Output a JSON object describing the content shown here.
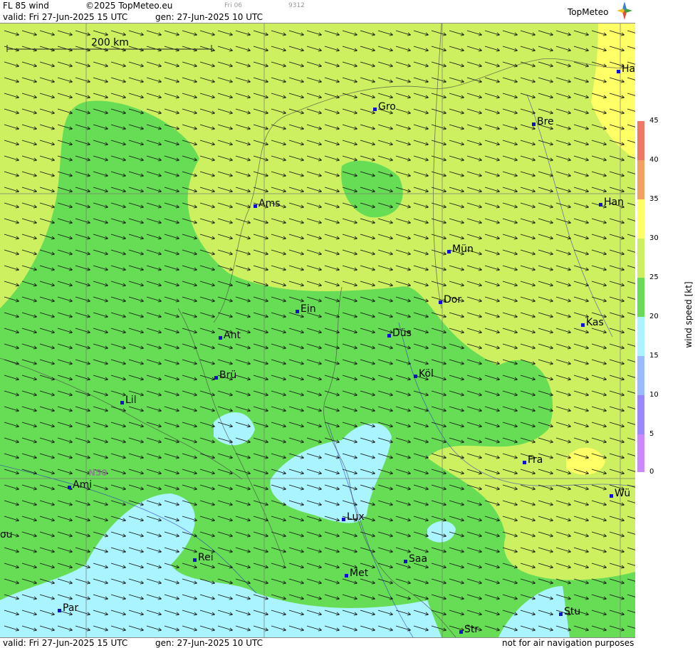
{
  "header": {
    "title": "FL 85 wind",
    "copyright": "©2025 TopMeteo.eu",
    "valid": "valid:  Fri  27-Jun-2025  15 UTC",
    "gen": "gen: 27-Jun-2025 10 UTC",
    "small_day": "Fri 06",
    "small_code": "9312",
    "logo": "TopMeteo"
  },
  "footer": {
    "valid": "valid:  Fri  27-Jun-2025  15 UTC",
    "gen": "gen: 27-Jun-2025 10 UTC",
    "disclaimer": "not for air navigation purposes"
  },
  "map": {
    "scale_label": "200 km",
    "lat_label": "N50",
    "cities": [
      "Ha",
      "Gro",
      "Bre",
      "Ams",
      "Han",
      "Mün",
      "Dor",
      "Ein",
      "Kas",
      "Ant",
      "Düs",
      "Brü",
      "Köl",
      "Lil",
      "Fra",
      "Ami",
      "Wü",
      "ou",
      "Lux",
      "Rei",
      "Saa",
      "Met",
      "Par",
      "Stu",
      "Str"
    ]
  },
  "legend": {
    "title": "wind  speed  [kt]",
    "ticks": [
      "45",
      "40",
      "35",
      "30",
      "25",
      "20",
      "15",
      "10",
      "5",
      "0"
    ],
    "colors": {
      "c40_45": "#ee7766",
      "c35_40": "#f4a060",
      "c30_35": "#ffff66",
      "c25_30": "#ccf060",
      "c20_25": "#66dd55",
      "c15_20": "#aaf4ff",
      "c10_15": "#99bbff",
      "c5_10": "#9988ff",
      "c0_5": "#cc88ff"
    }
  }
}
